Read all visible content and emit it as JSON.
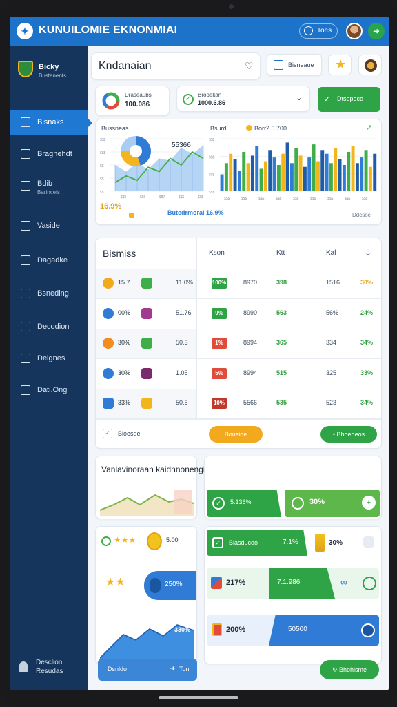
{
  "header": {
    "app_title": "KUNUILOMIE EKNONMIAI",
    "pill": "Toes"
  },
  "sidebar": {
    "brand_name": "Bicky",
    "brand_sub": "Bustenents",
    "items": [
      {
        "label": "Bisnaks"
      },
      {
        "label": "Bragnehdt"
      },
      {
        "label": "Bdib",
        "sub": "Barincels"
      },
      {
        "label": "Vaside"
      },
      {
        "label": "Dagadke"
      },
      {
        "label": "Bsneding"
      },
      {
        "label": "Decodion"
      },
      {
        "label": "Delgnes"
      },
      {
        "label": "Dati.Ong"
      }
    ],
    "footer": {
      "line1": "Desclion",
      "line2": "Resudas"
    }
  },
  "top": {
    "search_text": "Kndanaian",
    "btn_label": "Bisneaue",
    "stat1_label": "Draseaubs",
    "stat1_value": "100.086",
    "stat2_label": "Brooekan",
    "stat2_value": "1000.6.86",
    "green_btn": "Dtsopeco"
  },
  "charts_card": {
    "chart1": {
      "title": "Bussneas",
      "value_label": "55366",
      "pct": "16.9%",
      "footer": "Butedrmoral 16.9%",
      "ticks": [
        "$$9",
        "$$6",
        "$$7",
        "$$$",
        "$$$"
      ],
      "yticks": [
        "$$$",
        "$$$",
        "$$",
        "$$",
        "$$"
      ],
      "pie": [
        {
          "value": 45,
          "color": "#2f7bd5"
        },
        {
          "value": 30,
          "color": "#f2b51d"
        },
        {
          "value": 25,
          "color": "#a9cdf2"
        }
      ],
      "area": [
        24,
        18,
        26,
        20,
        30,
        28,
        40,
        34,
        42
      ],
      "line": [
        8,
        14,
        10,
        22,
        18,
        30,
        24,
        36,
        30
      ]
    },
    "chart2": {
      "title": "Bsurd",
      "value": "Borr2.5.700",
      "footer": "Ddcsoc",
      "ticks": [
        "$$$",
        "$$$",
        "$$$",
        "$$$",
        "$$$",
        "$$$",
        "$$$",
        "$$$",
        "$$$"
      ],
      "yticks": [
        "$$$",
        "$$$",
        "$$$",
        "$$$"
      ],
      "colors": [
        "#2f7bd5",
        "#3fae49",
        "#f2b51d",
        "#1e5ca8"
      ],
      "bars": [
        18,
        30,
        40,
        34,
        22,
        42,
        30,
        38,
        48,
        24,
        32,
        44,
        36,
        28,
        40,
        52,
        30,
        46,
        38,
        26,
        36,
        50,
        32,
        44,
        40,
        30,
        46,
        34,
        28,
        42,
        48,
        30,
        36,
        44,
        26,
        40
      ]
    }
  },
  "table": {
    "title": "Bismiss",
    "headers": [
      "Kson",
      "Ktt",
      "Kal"
    ],
    "rows": [
      {
        "a": "15.7",
        "c": "11.0%",
        "tag": "100%",
        "v1": "8970",
        "v2": "398",
        "v3": "1516",
        "v4": "30%"
      },
      {
        "a": "00%",
        "c": "51.76",
        "tag": "9%",
        "v1": "8990",
        "v2": "563",
        "v3": "56%",
        "v4": "24%"
      },
      {
        "a": "30%",
        "c": "50.3",
        "tag": "1%",
        "v1": "8994",
        "v2": "365",
        "v3": "334",
        "v4": "34%"
      },
      {
        "a": "30%",
        "c": "1.05",
        "tag": "5%",
        "v1": "8994",
        "v2": "515",
        "v3": "325",
        "v4": "33%"
      },
      {
        "a": "33%",
        "c": "50.6",
        "tag": "10%",
        "v1": "5566",
        "v2": "535",
        "v3": "523",
        "v4": "34%"
      }
    ],
    "footer_label": "Bloesde",
    "yellow_btn": "Bousioe",
    "green_btn": "Bhoedeos"
  },
  "bottom": {
    "title": "Vanlavinoraan kaidnnonengia",
    "p1": "5.136%",
    "p2": "30%",
    "r1_label": "Blasducoo",
    "r1_value": "7.1%",
    "r1_side": "30%",
    "pill_val": "5.00",
    "blue_pill": "250%",
    "r2_left": "217%",
    "r2_green": "7.1.986",
    "area_pct": "330%",
    "r3_left": "200%",
    "r3_blue": "50500",
    "left_btn": "Dsnldo",
    "left_btn_side": "Ton",
    "right_btn": "Bhohisme"
  }
}
